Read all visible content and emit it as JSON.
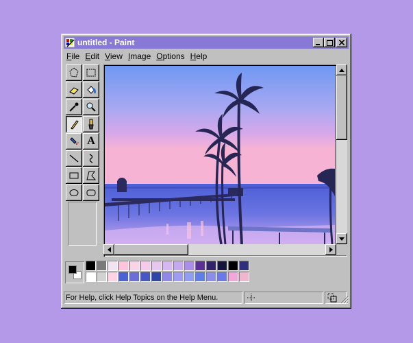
{
  "window": {
    "title": "untitled - Paint",
    "buttons": {
      "minimize": "_",
      "maximize": "□",
      "close": "✕"
    }
  },
  "menu": [
    {
      "id": "file",
      "mnemonic": "F",
      "rest": "ile"
    },
    {
      "id": "edit",
      "mnemonic": "E",
      "rest": "dit"
    },
    {
      "id": "view",
      "mnemonic": "V",
      "rest": "iew"
    },
    {
      "id": "image",
      "mnemonic": "I",
      "rest": "mage"
    },
    {
      "id": "options",
      "mnemonic": "O",
      "rest": "ptions"
    },
    {
      "id": "help",
      "mnemonic": "H",
      "rest": "elp"
    }
  ],
  "tools": {
    "text_tool_glyph": "A",
    "selected": "pencil",
    "icons": [
      "free-form-select-icon",
      "rect-select-icon",
      "eraser-icon",
      "fill-bucket-icon",
      "color-picker-icon",
      "magnifier-icon",
      "pencil-icon",
      "brush-icon",
      "airbrush-icon",
      "text-icon",
      "line-icon",
      "curve-icon",
      "rectangle-icon",
      "polygon-icon",
      "ellipse-icon",
      "rounded-rect-icon"
    ]
  },
  "colors": {
    "foreground": "#000000",
    "background": "#ffffff",
    "palette_top": [
      "#000000",
      "#7a7a7a",
      "#f2e3f2",
      "#ffc4dc",
      "#fbd3e8",
      "#f8c9ea",
      "#e7c6ef",
      "#d7b7f1",
      "#c4a8f0",
      "#aa8ee9",
      "#5b2f96",
      "#31236a",
      "#14143d",
      "#000000",
      "#2e2e7e"
    ],
    "palette_bottom": [
      "#ffffff",
      "#d2d2d2",
      "#ffd2e4",
      "#4b62d4",
      "#6b6ed8",
      "#4557c7",
      "#2e46a8",
      "#8f88ea",
      "#9d9cf2",
      "#8f9ef0",
      "#5f7ee8",
      "#8b8ee8",
      "#6a79e8",
      "#f0a8d8",
      "#f0b6d0"
    ]
  },
  "status": {
    "help_text": "For Help, click Help Topics on the Help Menu."
  },
  "canvas": {
    "sky_top": "#7aa2f3",
    "sky_mid": "#c6a3ee",
    "sky_horizon": "#f4b0d5",
    "water": "#5562d8"
  }
}
